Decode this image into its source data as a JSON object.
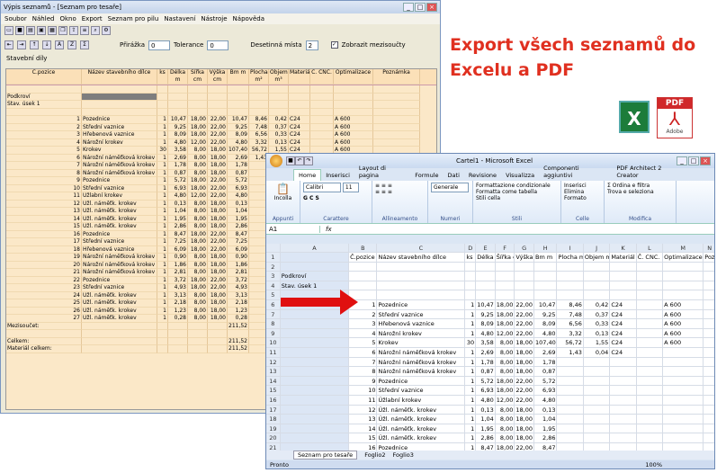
{
  "win1": {
    "title": "Výpis seznamů - [Seznam pro tesaře]",
    "menu": [
      "Soubor",
      "Náhled",
      "Okno",
      "Export",
      "Seznam pro pilu",
      "Nastavení",
      "Nástroje",
      "Nápověda"
    ],
    "priraska_label": "Přirážka",
    "priraska_value": "0",
    "tolerance_label": "Tolerance",
    "tolerance_value": "0",
    "desetinna_label": "Desetinná místa",
    "desetinna_value": "2",
    "mezisoucty_label": "Zobrazit mezisoučty",
    "section_label": "Stavební díly",
    "headers": [
      "Č.pozice",
      "Název stavebního dílce",
      "ks",
      "Délka m",
      "Šířka cm",
      "Výška cm",
      "Bm m",
      "Plocha m²",
      "Objem m³",
      "Materiál",
      "Č. CNC.",
      "Optimalizace",
      "Poznámka"
    ],
    "group1": "Podkroví",
    "group2": "Stav. úsek 1",
    "rows": [
      [
        "1",
        "Pozednice",
        "1",
        "10,47",
        "18,00",
        "22,00",
        "10,47",
        "8,46",
        "0,42",
        "C24",
        "",
        "A 600",
        ""
      ],
      [
        "2",
        "Střední vaznice",
        "1",
        "9,25",
        "18,00",
        "22,00",
        "9,25",
        "7,48",
        "0,37",
        "C24",
        "",
        "A 600",
        ""
      ],
      [
        "3",
        "Hřebenová vaznice",
        "1",
        "8,09",
        "18,00",
        "22,00",
        "8,09",
        "6,56",
        "0,33",
        "C24",
        "",
        "A 600",
        ""
      ],
      [
        "4",
        "Nárožní krokev",
        "1",
        "4,80",
        "12,00",
        "22,00",
        "4,80",
        "3,32",
        "0,13",
        "C24",
        "",
        "A 600",
        ""
      ],
      [
        "5",
        "Krokev",
        "30",
        "3,58",
        "8,00",
        "18,00",
        "107,40",
        "56,72",
        "1,55",
        "C24",
        "",
        "A 600",
        ""
      ],
      [
        "6",
        "Nárožní náměťková krokev",
        "1",
        "2,69",
        "8,00",
        "18,00",
        "2,69",
        "1,43",
        "0,04",
        "C24",
        "",
        "",
        ""
      ],
      [
        "7",
        "Nárožní náměťková krokev",
        "1",
        "1,78",
        "8,00",
        "18,00",
        "1,78",
        "",
        "",
        "",
        "",
        "",
        ""
      ],
      [
        "8",
        "Nárožní náměťková krokev",
        "1",
        "0,87",
        "8,00",
        "18,00",
        "0,87",
        "",
        "",
        "",
        "",
        "",
        ""
      ],
      [
        "9",
        "Pozednice",
        "1",
        "5,72",
        "18,00",
        "22,00",
        "5,72",
        "",
        "",
        "",
        "",
        "",
        ""
      ],
      [
        "10",
        "Střední vaznice",
        "1",
        "6,93",
        "18,00",
        "22,00",
        "6,93",
        "",
        "",
        "",
        "",
        "",
        ""
      ],
      [
        "11",
        "Úžlabní krokev",
        "1",
        "4,80",
        "12,00",
        "22,00",
        "4,80",
        "",
        "",
        "",
        "",
        "",
        ""
      ],
      [
        "12",
        "Úžl. náměťk. krokev",
        "1",
        "0,13",
        "8,00",
        "18,00",
        "0,13",
        "",
        "",
        "",
        "",
        "",
        ""
      ],
      [
        "13",
        "Úžl. náměťk. krokev",
        "1",
        "1,04",
        "8,00",
        "18,00",
        "1,04",
        "",
        "",
        "",
        "",
        "",
        ""
      ],
      [
        "14",
        "Úžl. náměťk. krokev",
        "1",
        "1,95",
        "8,00",
        "18,00",
        "1,95",
        "",
        "",
        "",
        "",
        "",
        ""
      ],
      [
        "15",
        "Úžl. náměťk. krokev",
        "1",
        "2,86",
        "8,00",
        "18,00",
        "2,86",
        "",
        "",
        "",
        "",
        "",
        ""
      ],
      [
        "16",
        "Pozednice",
        "1",
        "8,47",
        "18,00",
        "22,00",
        "8,47",
        "",
        "",
        "",
        "",
        "",
        ""
      ],
      [
        "17",
        "Střední vaznice",
        "1",
        "7,25",
        "18,00",
        "22,00",
        "7,25",
        "",
        "",
        "",
        "",
        "",
        ""
      ],
      [
        "18",
        "Hřebenová vaznice",
        "1",
        "6,09",
        "18,00",
        "22,00",
        "6,09",
        "",
        "",
        "",
        "",
        "",
        ""
      ],
      [
        "19",
        "Nárožní náměťková krokev",
        "1",
        "0,90",
        "8,00",
        "18,00",
        "0,90",
        "",
        "",
        "",
        "",
        "",
        ""
      ],
      [
        "20",
        "Nárožní náměťková krokev",
        "1",
        "1,86",
        "8,00",
        "18,00",
        "1,86",
        "",
        "",
        "",
        "",
        "",
        ""
      ],
      [
        "21",
        "Nárožní náměťková krokev",
        "1",
        "2,81",
        "8,00",
        "18,00",
        "2,81",
        "",
        "",
        "",
        "",
        "",
        ""
      ],
      [
        "22",
        "Pozednice",
        "1",
        "3,72",
        "18,00",
        "22,00",
        "3,72",
        "",
        "",
        "",
        "",
        "",
        ""
      ],
      [
        "23",
        "Střední vaznice",
        "1",
        "4,93",
        "18,00",
        "22,00",
        "4,93",
        "",
        "",
        "",
        "",
        "",
        ""
      ],
      [
        "24",
        "Úžl. náměťk. krokev",
        "1",
        "3,13",
        "8,00",
        "18,00",
        "3,13",
        "",
        "",
        "",
        "",
        "",
        ""
      ],
      [
        "25",
        "Úžl. náměťk. krokev",
        "1",
        "2,18",
        "8,00",
        "18,00",
        "2,18",
        "",
        "",
        "",
        "",
        "",
        ""
      ],
      [
        "26",
        "Úžl. náměťk. krokev",
        "1",
        "1,23",
        "8,00",
        "18,00",
        "1,23",
        "",
        "",
        "",
        "",
        "",
        ""
      ],
      [
        "27",
        "Úžl. náměťk. krokev",
        "1",
        "0,28",
        "8,00",
        "18,00",
        "0,28",
        "",
        "",
        "",
        "",
        "",
        ""
      ]
    ],
    "mezisoucet_label": "Mezisoučet:",
    "mezisoucet_value": "211,52",
    "celkem_label": "Celkem:",
    "celkem_value": "211,52",
    "material_label": "Materiál celkem:",
    "material_value": "211,52"
  },
  "headline": "Export všech seznamů do Excelu a PDF",
  "pdf_band": "PDF",
  "pdf_adobe": "Adobe",
  "excel_letter": "X",
  "win2": {
    "title": "Cartel1 - Microsoft Excel",
    "tabs": [
      "Home",
      "Inserisci",
      "Layout di pagina",
      "Formule",
      "Dati",
      "Revisione",
      "Visualizza",
      "Componenti aggiuntivi",
      "PDF Architect 2 Creator"
    ],
    "ribbon_groups": [
      "Appunti",
      "Carattere",
      "Allineamento",
      "Numeri",
      "Stili",
      "Celle",
      "Modifica"
    ],
    "paste_label": "Incolla",
    "font_name": "Calibri",
    "font_size": "11",
    "number_format": "Generale",
    "cond_format": "Formattazione condizionale",
    "format_table": "Formatta come tabella",
    "cell_styles": "Stili cella",
    "insert_label": "Inserisci",
    "delete_label": "Elimina",
    "format_label": "Formato",
    "sort_label": "Ordina e filtra",
    "find_label": "Trova e seleziona",
    "namebox": "A1",
    "fx": "fx",
    "cols": [
      "A",
      "B",
      "C",
      "D",
      "E",
      "F",
      "G",
      "H",
      "I",
      "J",
      "K",
      "L",
      "M",
      "N"
    ],
    "sheets": [
      "Seznam pro tesaře",
      "Foglio2",
      "Foglio3"
    ],
    "status": "Pronto",
    "zoom": "100%"
  }
}
